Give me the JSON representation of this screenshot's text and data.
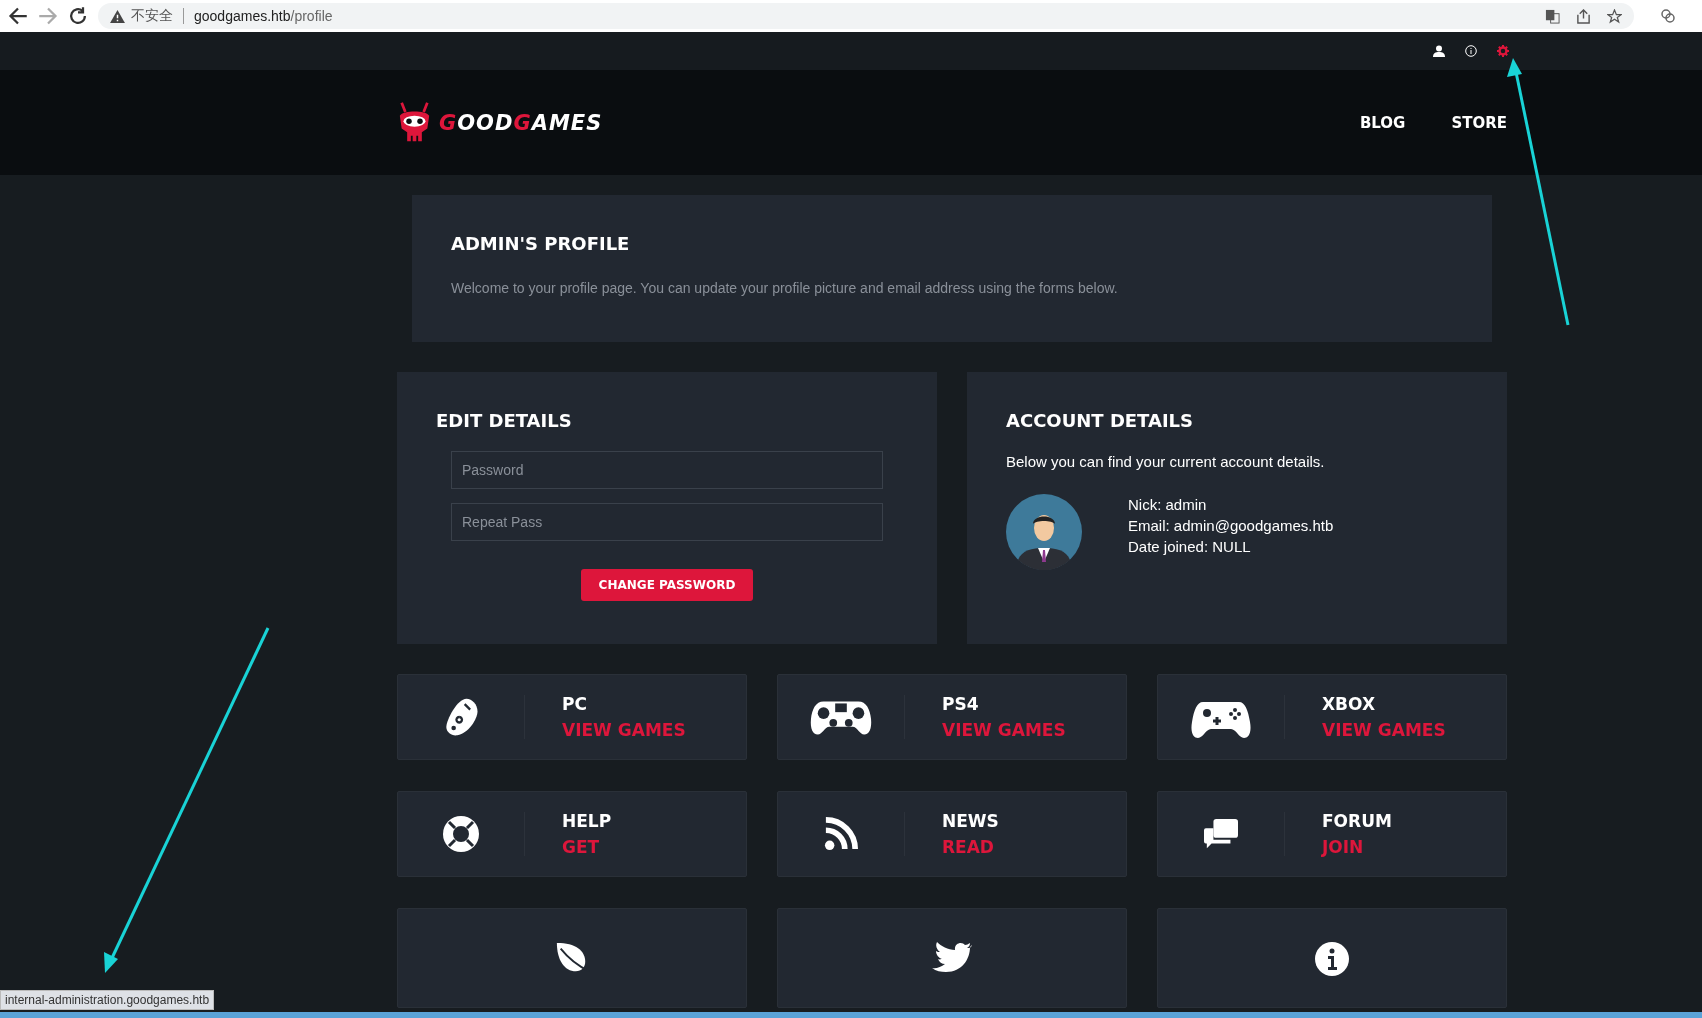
{
  "browser": {
    "back_enabled": true,
    "forward_enabled": false,
    "security_label": "不安全",
    "url_host": "goodgames.htb",
    "url_path": "/profile"
  },
  "topbar": {
    "icons": [
      {
        "kind": "user",
        "active": false
      },
      {
        "kind": "info",
        "active": false
      },
      {
        "kind": "gear",
        "active": true
      }
    ]
  },
  "header": {
    "logo": [
      {
        "text": "G",
        "accent": true
      },
      {
        "text": "OOD",
        "accent": false
      },
      {
        "text": "G",
        "accent": true
      },
      {
        "text": "AMES",
        "accent": false
      }
    ],
    "nav": [
      "BLOG",
      "STORE"
    ]
  },
  "profile": {
    "title": "ADMIN'S PROFILE",
    "text": "Welcome to your profile page. You can update your profile picture and email address using the forms below."
  },
  "edit_details": {
    "title": "EDIT DETAILS",
    "fields": [
      {
        "placeholder": "Password"
      },
      {
        "placeholder": "Repeat Pass"
      }
    ],
    "button": "CHANGE PASSWORD"
  },
  "account_details": {
    "title": "ACCOUNT DETAILS",
    "intro": "Below you can find your current account details.",
    "lines": [
      "Nick: admin",
      "Email: admin@goodgames.htb",
      "Date joined: NULL"
    ]
  },
  "tiles": [
    {
      "kind": "mouse",
      "title": "PC",
      "link": "VIEW GAMES"
    },
    {
      "kind": "gamepad",
      "title": "PS4",
      "link": "VIEW GAMES"
    },
    {
      "kind": "xbox",
      "title": "XBOX",
      "link": "VIEW GAMES"
    },
    {
      "kind": "lifebuoy",
      "title": "HELP",
      "link": "GET"
    },
    {
      "kind": "rss",
      "title": "NEWS",
      "link": "READ"
    },
    {
      "kind": "chat",
      "title": "FORUM",
      "link": "JOIN"
    },
    {
      "kind": "leaf"
    },
    {
      "kind": "bird"
    },
    {
      "kind": "info"
    }
  ],
  "status_bar": {
    "link_preview": "internal-administration.goodgames.htb"
  }
}
